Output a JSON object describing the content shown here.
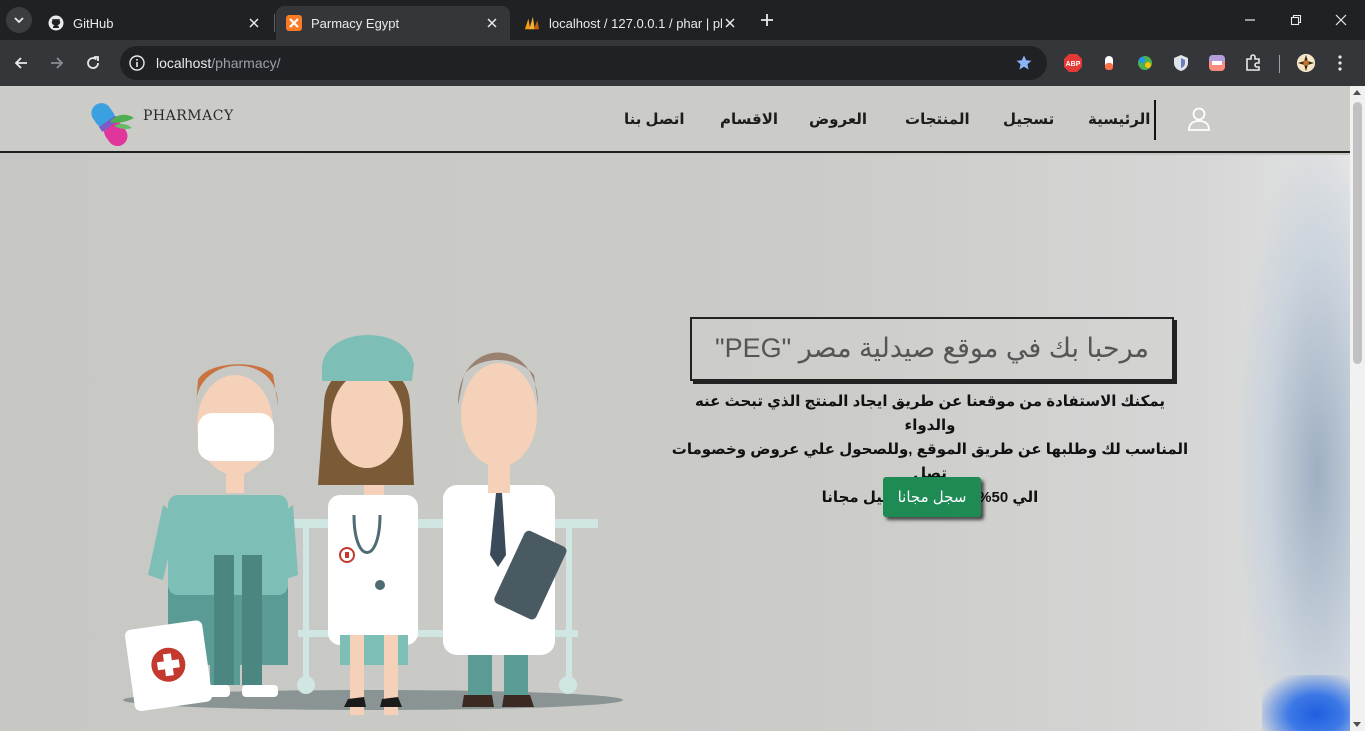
{
  "browser": {
    "tabs": [
      {
        "title": "GitHub",
        "icon": "github-icon"
      },
      {
        "title": "Parmacy Egypt",
        "icon": "xampp-icon"
      },
      {
        "title": "localhost / 127.0.0.1 / phar | ph",
        "icon": "phpmyadmin-icon"
      }
    ],
    "address": {
      "host": "localhost",
      "path": "/pharmacy/"
    },
    "extensions": [
      "adblock-icon",
      "extension-icon",
      "extension-icon",
      "shield-icon",
      "extension-icon",
      "puzzle-icon"
    ]
  },
  "page": {
    "logo_text": "PHARMACY",
    "nav": {
      "home": "الرئيسية",
      "register": "تسجيل",
      "products": "المنتجات",
      "offers": "العروض",
      "categories": "الاقسام",
      "contact": "اتصل بنا"
    },
    "hero": {
      "headline": "مرحبا بك في موقع صيدلية مصر \"PEG\"",
      "line1": "يمكنك الاستفادة من موقعنا عن طريق ايجاد المنتج الذي تبحث عنه والدواء",
      "line2": "المناسب لك وطلبها عن طريق الموقع ,وللصحول علي عروض وخصومات تصل",
      "line3": "الي 50% يمكنك التسجيل مجانا",
      "cta": "سجل مجانا"
    },
    "colors": {
      "cta": "#1e8a54",
      "navbar": "#cbcbc7",
      "hero_bg": "#c8c8c5"
    }
  }
}
